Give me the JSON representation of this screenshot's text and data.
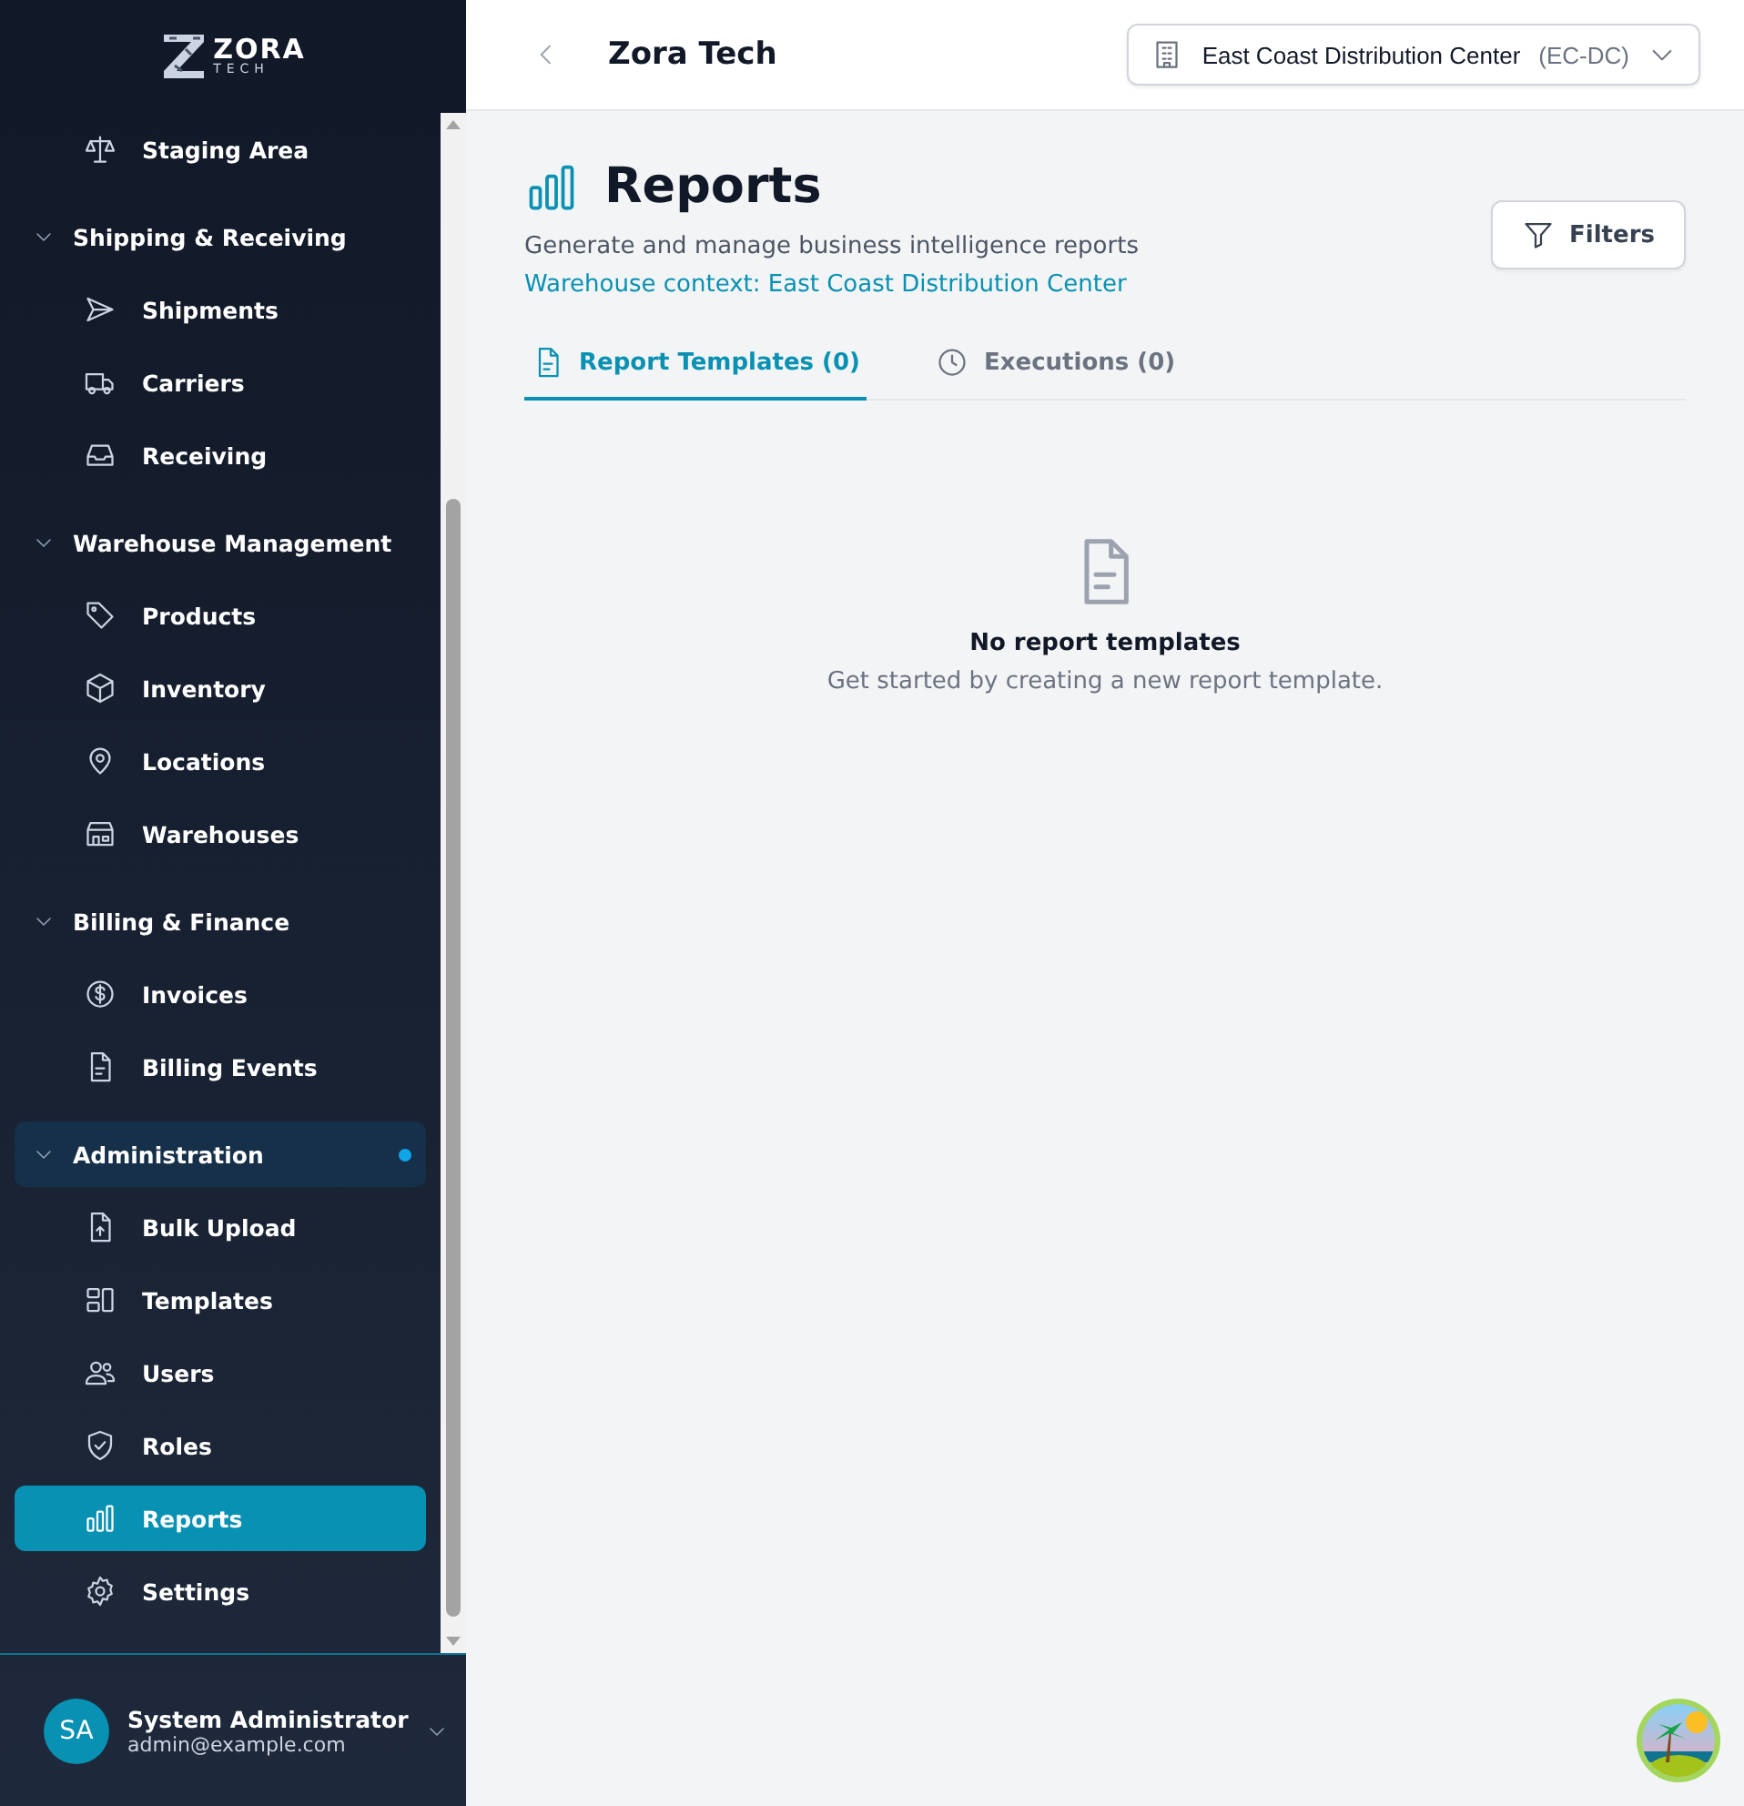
{
  "sidebar": {
    "logo": {
      "word": "ZORA",
      "sub": "TECH"
    },
    "nav": [
      {
        "kind": "link",
        "label": "Staging Area",
        "selected": false
      },
      {
        "kind": "group",
        "label": "Shipping & Receiving",
        "expanded": true,
        "current": false,
        "children": [
          {
            "label": "Shipments",
            "selected": false
          },
          {
            "label": "Carriers",
            "selected": false
          },
          {
            "label": "Receiving",
            "selected": false
          }
        ]
      },
      {
        "kind": "group",
        "label": "Warehouse Management",
        "expanded": true,
        "current": false,
        "children": [
          {
            "label": "Products",
            "selected": false
          },
          {
            "label": "Inventory",
            "selected": false
          },
          {
            "label": "Locations",
            "selected": false
          },
          {
            "label": "Warehouses",
            "selected": false
          }
        ]
      },
      {
        "kind": "group",
        "label": "Billing & Finance",
        "expanded": true,
        "current": false,
        "children": [
          {
            "label": "Invoices",
            "selected": false
          },
          {
            "label": "Billing Events",
            "selected": false
          }
        ]
      },
      {
        "kind": "group",
        "label": "Administration",
        "expanded": true,
        "current": true,
        "children": [
          {
            "label": "Bulk Upload",
            "selected": false
          },
          {
            "label": "Templates",
            "selected": false
          },
          {
            "label": "Users",
            "selected": false
          },
          {
            "label": "Roles",
            "selected": false
          },
          {
            "label": "Reports",
            "selected": true
          }
        ]
      },
      {
        "kind": "link",
        "label": "Settings",
        "selected": false
      }
    ],
    "user": {
      "initials": "SA",
      "name": "System Administrator",
      "email": "admin@example.com"
    }
  },
  "header": {
    "title": "Zora Tech",
    "warehouse": {
      "name": "East Coast Distribution Center",
      "code": "(EC-DC)"
    }
  },
  "page": {
    "title": "Reports",
    "subtitle": "Generate and manage business intelligence reports",
    "context": "Warehouse context: East Coast Distribution Center",
    "filters_button": "Filters",
    "tabs": [
      {
        "label": "Report Templates (0)",
        "selected": true
      },
      {
        "label": "Executions (0)",
        "selected": false
      }
    ],
    "empty_state": {
      "title": "No report templates",
      "message": "Get started by creating a new report template."
    }
  }
}
